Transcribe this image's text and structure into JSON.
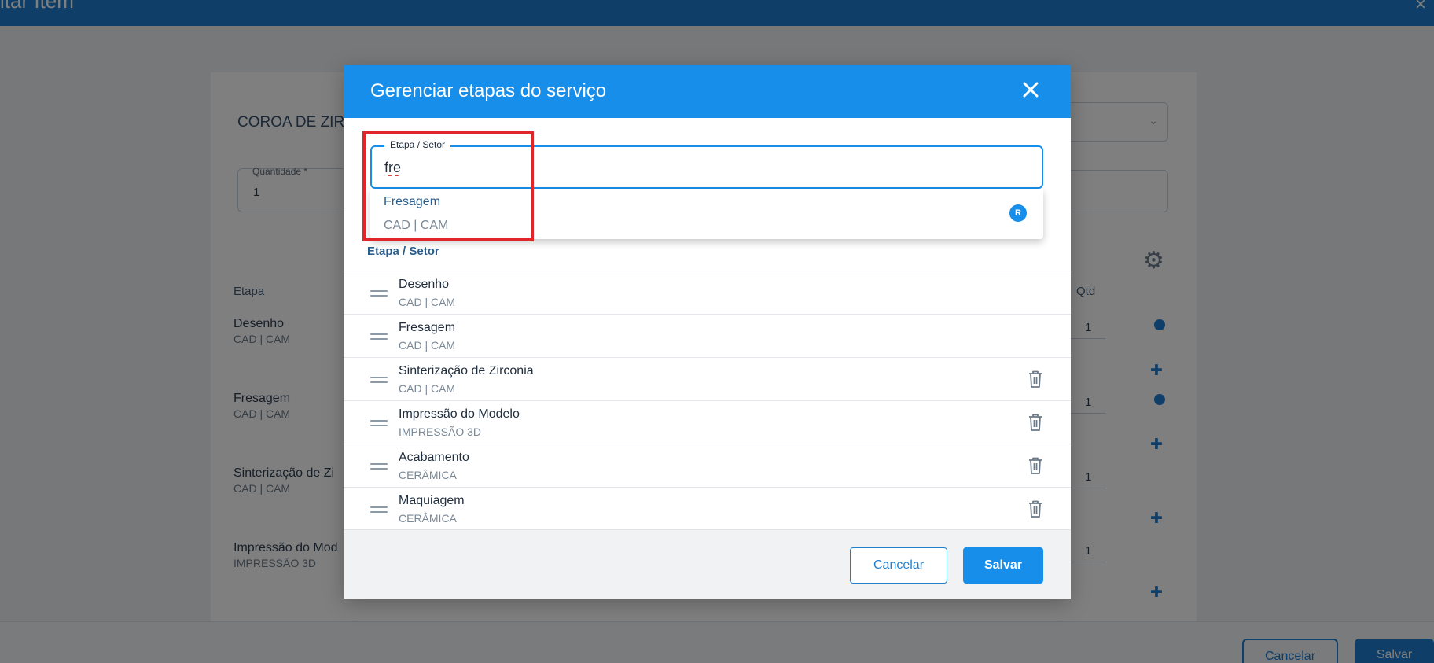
{
  "background": {
    "title": "itar Item",
    "close_symbol": "×",
    "service_code": "COROA DE ZIRC",
    "quantity_label": "Quantidade *",
    "quantity_value": "1",
    "columns": {
      "step": "Etapa",
      "qty": "Qtd"
    },
    "rows": [
      {
        "title": "Desenho",
        "subtitle": "CAD | CAM",
        "qty": "1"
      },
      {
        "title": "Fresagem",
        "subtitle": "CAD | CAM",
        "qty": "1"
      },
      {
        "title": "Sinterização de Zi",
        "subtitle": "CAD | CAM",
        "qty": "1"
      },
      {
        "title": "Impressão do Mod",
        "subtitle": "IMPRESSÃO 3D",
        "qty": "1"
      }
    ],
    "footer": {
      "cancel_label": "Cancelar",
      "save_label": "Salvar"
    }
  },
  "modal": {
    "title": "Gerenciar etapas do serviço",
    "field": {
      "label": "Etapa / Setor",
      "value": "fre"
    },
    "suggestion": {
      "title": "Fresagem",
      "subtitle": "CAD | CAM",
      "badge": "R"
    },
    "list_header": "Etapa / Setor",
    "steps": [
      {
        "title": "Desenho",
        "subtitle": "CAD | CAM",
        "deletable": false
      },
      {
        "title": "Fresagem",
        "subtitle": "CAD | CAM",
        "deletable": false
      },
      {
        "title": "Sinterização de Zirconia",
        "subtitle": "CAD | CAM",
        "deletable": true
      },
      {
        "title": "Impressão do Modelo",
        "subtitle": "IMPRESSÃO 3D",
        "deletable": true
      },
      {
        "title": "Acabamento",
        "subtitle": "CERÂMICA",
        "deletable": true
      },
      {
        "title": "Maquiagem",
        "subtitle": "CERÂMICA",
        "deletable": true
      }
    ],
    "footer": {
      "cancel_label": "Cancelar",
      "save_label": "Salvar"
    }
  },
  "icons": {
    "close": "close-icon",
    "drag": "drag-handle-icon",
    "trash": "trash-icon",
    "gear": "gear-icon",
    "person_add": "person-add-icon",
    "chevron": "chevron-down-icon"
  },
  "colors": {
    "primary": "#168eea",
    "highlight": "#e0252b",
    "header_bg": "#168eea",
    "footer_bg": "#f0f2f4"
  }
}
